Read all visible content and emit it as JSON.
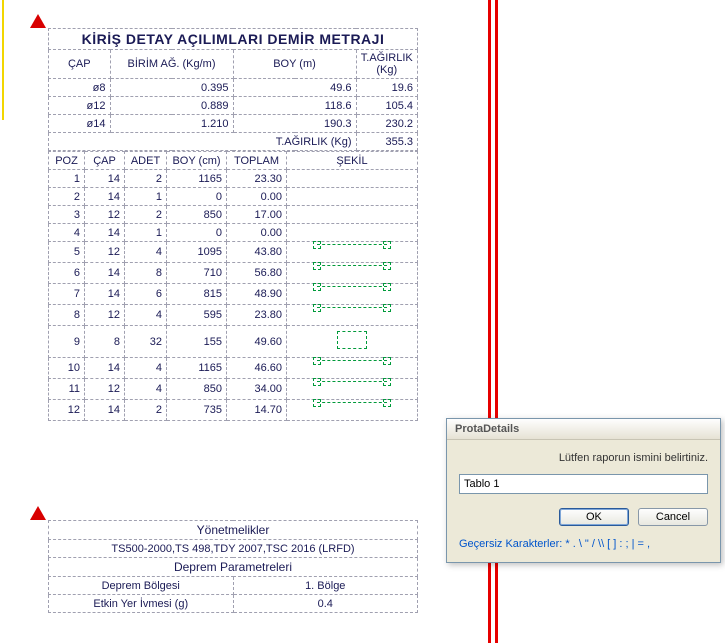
{
  "report1": {
    "title": "KİRİŞ DETAY AÇILIMLARI  DEMİR METRAJI",
    "hdr_cap": "ÇAP",
    "hdr_birimag": "BİRİM AĞ. (Kg/m)",
    "hdr_boy_m": "BOY (m)",
    "hdr_tagirlik": "T.AĞIRLIK (Kg)",
    "weights": [
      {
        "cap": "ø8",
        "birim": "0.395",
        "boy": "49.6",
        "t": "19.6"
      },
      {
        "cap": "ø12",
        "birim": "0.889",
        "boy": "118.6",
        "t": "105.4"
      },
      {
        "cap": "ø14",
        "birim": "1.210",
        "boy": "190.3",
        "t": "230.2"
      }
    ],
    "total_label": "T.AĞIRLIK (Kg)",
    "total_value": "355.3",
    "hdr_poz": "POZ",
    "hdr_cap2": "ÇAP",
    "hdr_adet": "ADET",
    "hdr_boycm": "BOY (cm)",
    "hdr_toplam": "TOPLAM",
    "hdr_sekil": "ŞEKİL",
    "rows": [
      {
        "poz": "1",
        "cap": "14",
        "adet": "2",
        "boy": "1165",
        "top": "23.30",
        "shape": ""
      },
      {
        "poz": "2",
        "cap": "14",
        "adet": "1",
        "boy": "0",
        "top": "0.00",
        "shape": ""
      },
      {
        "poz": "3",
        "cap": "12",
        "adet": "2",
        "boy": "850",
        "top": "17.00",
        "shape": ""
      },
      {
        "poz": "4",
        "cap": "14",
        "adet": "1",
        "boy": "0",
        "top": "0.00",
        "shape": ""
      },
      {
        "poz": "5",
        "cap": "12",
        "adet": "4",
        "boy": "1095",
        "top": "43.80",
        "shape": "bar"
      },
      {
        "poz": "6",
        "cap": "14",
        "adet": "8",
        "boy": "710",
        "top": "56.80",
        "shape": "bar"
      },
      {
        "poz": "7",
        "cap": "14",
        "adet": "6",
        "boy": "815",
        "top": "48.90",
        "shape": "bar"
      },
      {
        "poz": "8",
        "cap": "12",
        "adet": "4",
        "boy": "595",
        "top": "23.80",
        "shape": "bar"
      },
      {
        "poz": "9",
        "cap": "8",
        "adet": "32",
        "boy": "155",
        "top": "49.60",
        "shape": "box"
      },
      {
        "poz": "10",
        "cap": "14",
        "adet": "4",
        "boy": "1165",
        "top": "46.60",
        "shape": "bar"
      },
      {
        "poz": "11",
        "cap": "12",
        "adet": "4",
        "boy": "850",
        "top": "34.00",
        "shape": "bar"
      },
      {
        "poz": "12",
        "cap": "14",
        "adet": "2",
        "boy": "735",
        "top": "14.70",
        "shape": "bar"
      }
    ]
  },
  "report2": {
    "title": "Yönetmelikler",
    "codes": "TS500-2000,TS 498,TDY 2007,TSC 2016 (LRFD)",
    "subhead": "Deprem Parametreleri",
    "rows": [
      {
        "k": "Deprem Bölgesi",
        "v": "1. Bölge"
      },
      {
        "k": "Etkin Yer İvmesi (g)",
        "v": "0.4"
      }
    ]
  },
  "dialog": {
    "title": "ProtaDetails",
    "message": "Lütfen raporun ismini belirtiniz.",
    "value": "Tablo 1",
    "ok": "OK",
    "cancel": "Cancel",
    "invalid_label": "Geçersiz Karakterler: ",
    "invalid_chars": "* . \\ \" / \\\\ [ ] : ; | = ,"
  }
}
